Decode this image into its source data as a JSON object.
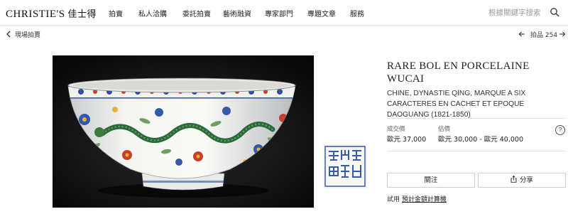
{
  "header": {
    "logo_en": "CHRISTIE'S",
    "logo_cjk": "佳士得",
    "nav": [
      {
        "label": "拍賣"
      },
      {
        "label": "私人洽購"
      },
      {
        "label": "委託拍賣"
      },
      {
        "label": "藝術融資"
      },
      {
        "label": "專家部門"
      },
      {
        "label": "專題文章"
      },
      {
        "label": "服務"
      }
    ],
    "search_placeholder": "根據關鍵字搜索",
    "search_icon": "search-icon"
  },
  "subnav": {
    "back_label": "現場拍賣",
    "lot_label": "拍品 254"
  },
  "lot": {
    "title": "RARE BOL EN PORCELAINE WUCAI",
    "subtitle": "CHINE, DYNASTIE QING, MARQUE A SIX CARACTERES EN CACHET ET EPOQUE DAOGUANG (1821-1850)",
    "sold_label": "成交價",
    "sold_value": "歐元 37,000",
    "estimate_label": "估價",
    "estimate_value": "歐元 30,000 - 歐元 40,000",
    "help": "?"
  },
  "actions": {
    "follow_label": "關注",
    "share_label": "分享",
    "calc_prefix": "試用",
    "calc_link": "預計金額計算機"
  },
  "colors": {
    "accent": "#222222",
    "image_bg": "#0b0b0b",
    "mark_blue": "#3a5aa8"
  }
}
